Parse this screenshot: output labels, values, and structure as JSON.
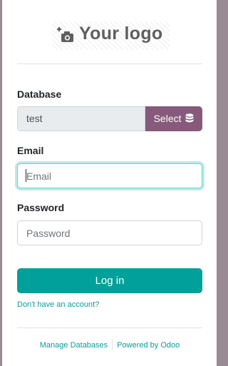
{
  "logo": {
    "text": "Your logo",
    "icon": "camera-plus-icon"
  },
  "database": {
    "label": "Database",
    "value": "test",
    "select_label": "Select",
    "select_icon": "database-icon"
  },
  "email": {
    "label": "Email",
    "value": "",
    "placeholder": "Email"
  },
  "password": {
    "label": "Password",
    "value": "",
    "placeholder": "Password"
  },
  "login_button": "Log in",
  "signup_link": "Don't have an account?",
  "footer": {
    "manage_databases": "Manage Databases",
    "powered_by": "Powered by Odoo"
  },
  "colors": {
    "primary": "#01a09a",
    "select_button": "#875a7b",
    "focus_border": "#5dd8ce",
    "backdrop": "#9a8a96"
  }
}
